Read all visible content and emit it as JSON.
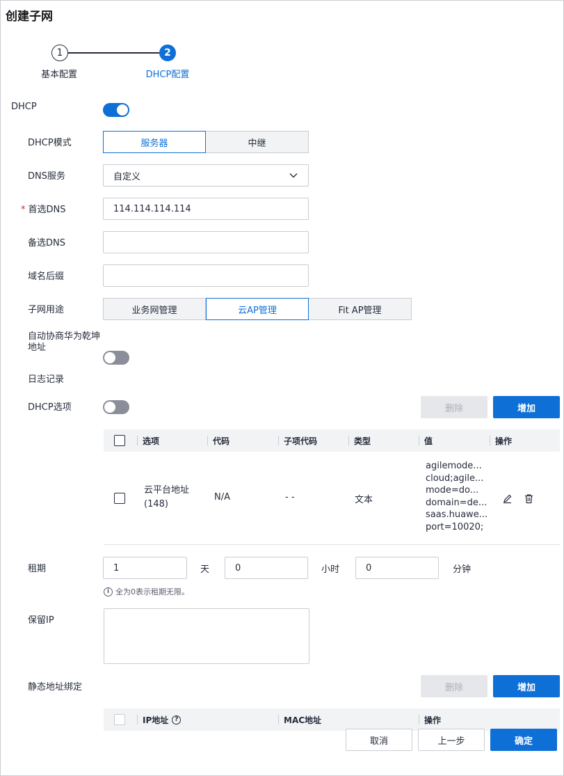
{
  "page": {
    "title": "创建子网"
  },
  "steps": [
    {
      "num": "1",
      "label": "基本配置"
    },
    {
      "num": "2",
      "label": "DHCP配置"
    }
  ],
  "form": {
    "dhcp_label": "DHCP",
    "dhcp_enabled": true,
    "mode": {
      "label": "DHCP模式",
      "options": [
        "服务器",
        "中继"
      ],
      "selected": "服务器"
    },
    "dns_service": {
      "label": "DNS服务",
      "value": "自定义"
    },
    "primary_dns": {
      "label": "首选DNS",
      "required_mark": "*",
      "value": "114.114.114.114"
    },
    "secondary_dns": {
      "label": "备选DNS",
      "value": ""
    },
    "domain_suffix": {
      "label": "域名后缀",
      "value": ""
    },
    "subnet_usage": {
      "label": "子网用途",
      "options": [
        "业务网管理",
        "云AP管理",
        "Fit AP管理"
      ],
      "selected": "云AP管理"
    },
    "auto_negotiate": {
      "label": "自动协商华为乾坤地址",
      "enabled": false
    },
    "log_record": {
      "label": "日志记录",
      "enabled": false
    },
    "dhcp_options": {
      "label": "DHCP选项",
      "delete_label": "删除",
      "add_label": "增加",
      "columns": [
        "选项",
        "代码",
        "子项代码",
        "类型",
        "值",
        "操作"
      ],
      "rows": [
        {
          "option_line1": "云平台地址",
          "option_line2": "(148)",
          "code": "N/A",
          "sub_code": "- -",
          "type": "文本",
          "value_lines": [
            "agilemode...",
            "cloud;agile...",
            "mode=do...",
            "domain=de...",
            "saas.huawe...",
            "port=10020;"
          ]
        }
      ]
    },
    "lease": {
      "label": "租期",
      "days": "1",
      "days_unit": "天",
      "hours": "0",
      "hours_unit": "小时",
      "minutes": "0",
      "minutes_unit": "分钟",
      "hint": "全为0表示租期无限。"
    },
    "reserved_ip": {
      "label": "保留IP",
      "value": ""
    },
    "static_binding": {
      "label": "静态地址绑定",
      "delete_label": "删除",
      "add_label": "增加",
      "columns": [
        "IP地址",
        "MAC地址",
        "操作"
      ]
    }
  },
  "footer": {
    "cancel_label": "取消",
    "prev_label": "上一步",
    "confirm_label": "确定"
  },
  "colors": {
    "primary": "#0e6fd6",
    "required": "#e5202d",
    "border": "#c9ccd2",
    "header_bg": "#f2f3f5"
  }
}
